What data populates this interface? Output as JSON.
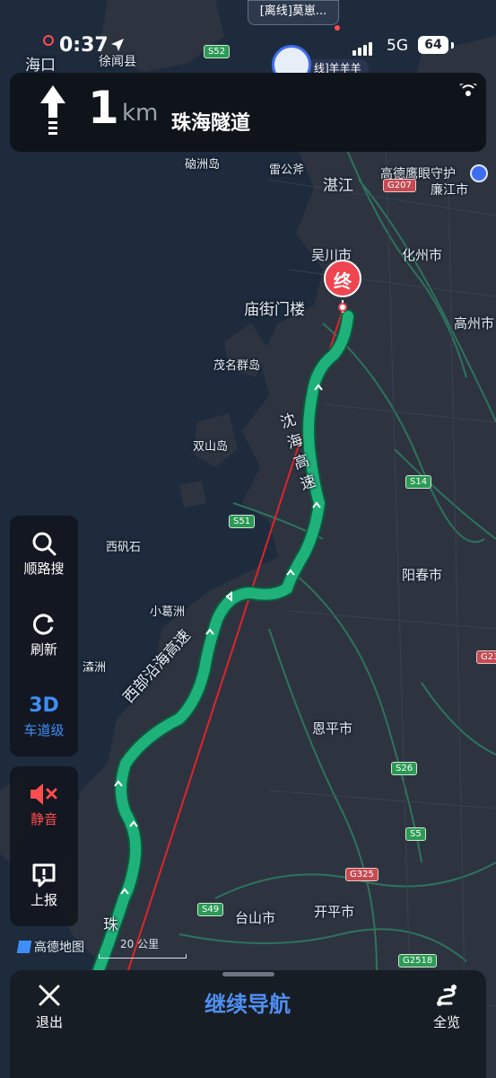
{
  "status_bar": {
    "time": "0:37",
    "network": "5G",
    "battery": "64"
  },
  "top_pill": {
    "label": "[离线]莫崽..."
  },
  "avatar_tag": {
    "label": "线]羊羊羊"
  },
  "nav_banner": {
    "distance_value": "1",
    "distance_unit": "km",
    "road_name": "珠海隧道",
    "direction_icon": "straight-arrow-icon"
  },
  "map_labels": {
    "haikou": "海口",
    "xuwen": "徐闻县",
    "naozhou": "硇洲岛",
    "leigong": "雷公斧",
    "zhanjiang": "湛江",
    "gaode_eye": "高德鹰眼守护",
    "lianjiang": "廉江市",
    "wuchuan": "吴川市",
    "huazhou": "化州市",
    "miaojie": "庙街门楼",
    "gaozhou": "高州市",
    "maoming_islands": "茂名群岛",
    "shuangshan": "双山岛",
    "xiqiaoshi": "西矾石",
    "xiaogezhou": "小葛洲",
    "yangchun": "阳春市",
    "chanzhou": "潹洲",
    "enping": "恩平市",
    "taishan": "台山市",
    "kaiping": "开平市",
    "shenhai_expressway": "沈海高速",
    "western_coastal_expressway": "西部沿海高速",
    "zhu_label": "珠",
    "end_marker": "终"
  },
  "road_shields": {
    "s52": "S52",
    "g207": "G207",
    "s14": "S14",
    "s51": "S51",
    "s26": "S26",
    "s5": "S5",
    "g325": "G325",
    "s49": "S49",
    "g2518": "G2518",
    "g23": "G23"
  },
  "left_panel": {
    "search_along": "顺路搜",
    "refresh": "刷新",
    "threed_label": "3D",
    "lane_level": "车道级",
    "mute": "静音",
    "report": "上报"
  },
  "map_footer": {
    "scale": "20 公里",
    "brand": "高德地图"
  },
  "bottom_bar": {
    "exit": "退出",
    "continue": "继续导航",
    "overview": "全览"
  },
  "colors": {
    "route": "#1eb27a",
    "accent": "#3e8ef7",
    "mute_red": "#ff4d4f",
    "end_marker": "#ef4550",
    "guide_line": "#e0242a"
  }
}
